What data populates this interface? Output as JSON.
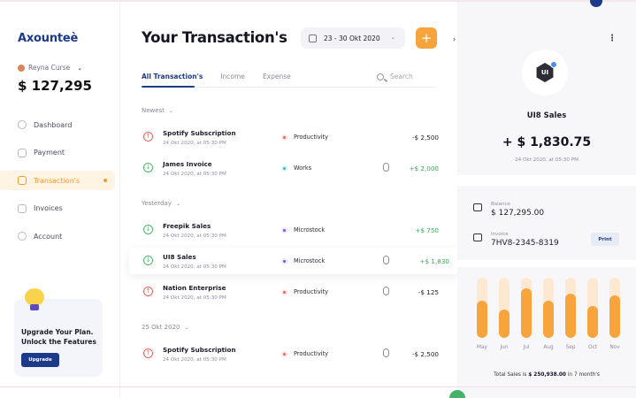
{
  "colors": {
    "brand": "#1d3a8a",
    "accent": "#f7a43c",
    "positive": "#3ba85a",
    "negative": "#e8665c"
  },
  "sidebar": {
    "logo": "Axounteè",
    "user_name": "Reyna Curse",
    "balance": "$ 127,295",
    "nav": [
      {
        "label": "Dashboard",
        "icon": "dashboard-icon"
      },
      {
        "label": "Payment",
        "icon": "card-icon"
      },
      {
        "label": "Transaction's",
        "icon": "bag-icon",
        "active": true
      },
      {
        "label": "Invoices",
        "icon": "invoice-icon"
      },
      {
        "label": "Account",
        "icon": "account-icon"
      }
    ],
    "upgrade": {
      "text_line1": "Upgrade Your Plan.",
      "text_line2": "Unlock the Features",
      "button": "Upgrade"
    }
  },
  "main": {
    "title": "Your Transaction's",
    "date_range": "23 - 30 Okt 2020",
    "add_label": "+",
    "tabs": [
      "All Transaction's",
      "Income",
      "Expense"
    ],
    "search_placeholder": "Search",
    "sections": [
      {
        "label": "Newest"
      },
      {
        "label": "Yesterday"
      },
      {
        "label": "25 Okt 2020"
      }
    ],
    "transactions": [
      {
        "name": "Spotify Subscription",
        "date": "24 Okt 2020, at 05:30 PM",
        "category": "Productivity",
        "amount": "-$ 2,500",
        "direction": "out",
        "attachment": false
      },
      {
        "name": "James Invoice",
        "date": "24 Okt 2020, at 05:30 PM",
        "category": "Works",
        "amount": "+$ 2,000",
        "direction": "in",
        "attachment": true
      },
      {
        "name": "Freepik Sales",
        "date": "24 Okt 2020, at 05:30 PM",
        "category": "Microstock",
        "amount": "+$ 750",
        "direction": "in",
        "attachment": false
      },
      {
        "name": "UI8 Sales",
        "date": "24 Okt 2020, at 05:30 PM",
        "category": "Microstock",
        "amount": "+$ 1,830",
        "direction": "in",
        "attachment": true,
        "selected": true
      },
      {
        "name": "Nation Enterprise",
        "date": "24 Okt 2020, at 05:30 PM",
        "category": "Productivity",
        "amount": "-$ 125",
        "direction": "out",
        "attachment": true
      },
      {
        "name": "Spotify Subscription",
        "date": "24 Okt 2020, at 05:30 PM",
        "category": "Productivity",
        "amount": "-$ 2,500",
        "direction": "out",
        "attachment": true
      }
    ]
  },
  "detail": {
    "logo_text": "UI",
    "name": "UI8 Sales",
    "amount": "+ $ 1,830.75",
    "date": "24 Okt 2020, at 05:30 PM",
    "balance_label": "Balance",
    "balance_value": "$ 127,295.00",
    "invoice_label": "Invoice",
    "invoice_value": "7HV8-2345-8319",
    "print_label": "Print",
    "chart_data": {
      "type": "bar",
      "categories": [
        "May",
        "Jun",
        "Jul",
        "Aug",
        "Sep",
        "Oct",
        "Nov"
      ],
      "values": [
        0.62,
        0.47,
        0.82,
        0.62,
        0.73,
        0.53,
        0.7
      ],
      "ylim": [
        0,
        1
      ]
    },
    "total_prefix": "Total Sales is",
    "total_value": "$ 250,938.00",
    "total_suffix": "in 7 month's"
  }
}
